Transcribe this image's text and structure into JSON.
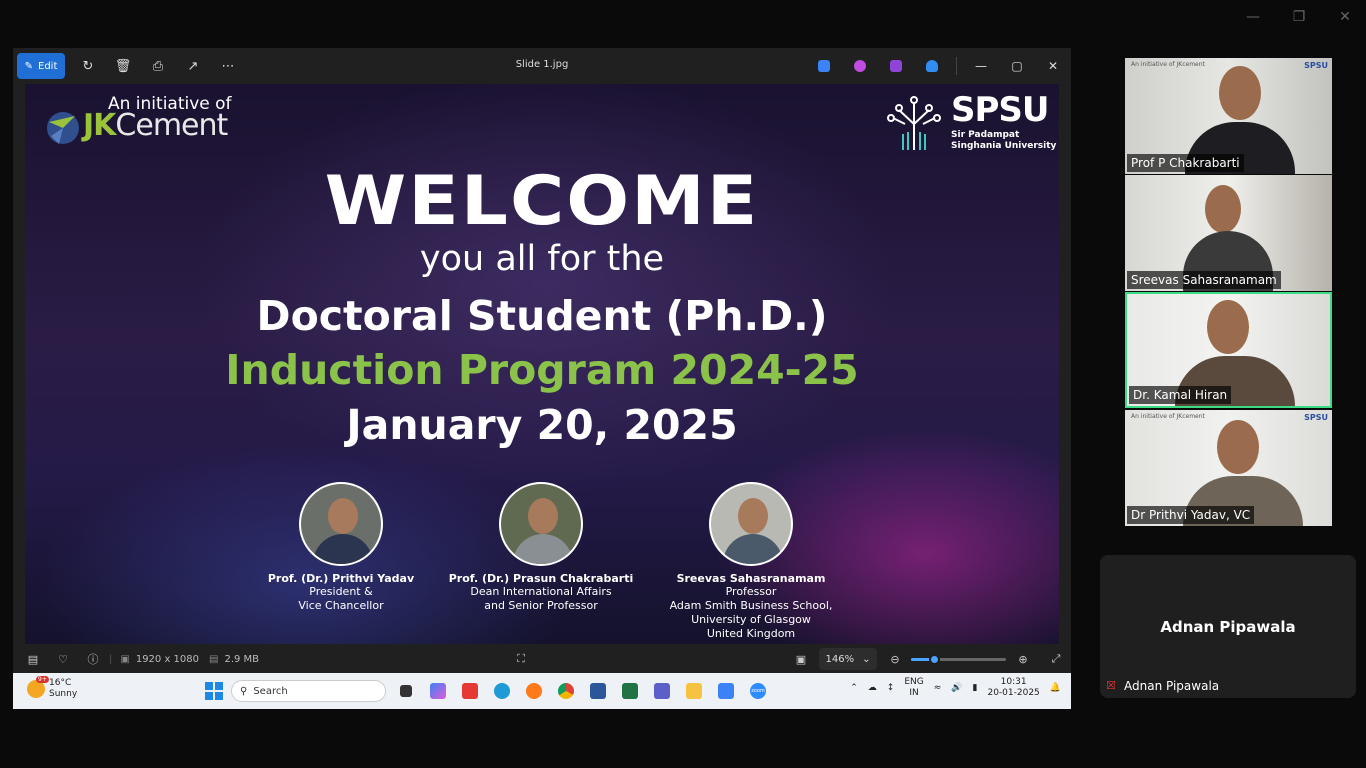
{
  "window": {
    "title": "Slide 1.jpg"
  },
  "toolbar": {
    "edit_label": "Edit"
  },
  "slide": {
    "initiative": "An initiative of",
    "jk_brand": {
      "jk": "JK",
      "cement": "Cement"
    },
    "spsu": {
      "name": "SPSU",
      "sub_line1": "Sir Padampat",
      "sub_line2": "Singhania University"
    },
    "welcome": "WELCOME",
    "line_you": "you all for the",
    "line_doc": "Doctoral Student (Ph.D.)",
    "line_ind": "Induction Program 2024-25",
    "line_date": "January 20, 2025",
    "speakers": [
      {
        "name": "Prof. (Dr.) Prithvi Yadav",
        "role1": "President &",
        "role2": "Vice Chancellor",
        "role3": "",
        "role4": ""
      },
      {
        "name": "Prof. (Dr.) Prasun Chakrabarti",
        "role1": "Dean International Affairs",
        "role2": "and Senior Professor",
        "role3": "",
        "role4": ""
      },
      {
        "name": "Sreevas Sahasranamam",
        "role1": "Professor",
        "role2": "Adam Smith Business School,",
        "role3": "University of Glasgow",
        "role4": "United Kingdom"
      }
    ]
  },
  "statusbar": {
    "resolution": "1920 x 1080",
    "size": "2.9 MB",
    "zoom": "146%",
    "zoom_level": 0.24
  },
  "taskbar": {
    "weather_temp": "16°C",
    "weather_desc": "Sunny",
    "weather_badge": "9+",
    "search_label": "Search",
    "lang": "ENG",
    "region": "IN",
    "time": "10:31",
    "date": "20-01-2025",
    "zoom_app_label": "zoom"
  },
  "participants": [
    {
      "name": "Prof P Chakrabarti"
    },
    {
      "name": "Sreevas Sahasranamam"
    },
    {
      "name": "Dr. Kamal Hiran"
    },
    {
      "name": "Dr Prithvi Yadav, VC"
    }
  ],
  "self_tile": {
    "name": "Adnan Pipawala",
    "label": "Adnan Pipawala"
  },
  "colors": {
    "accent_green": "#8bc34a",
    "active_border": "#3ddc84",
    "edit_blue": "#1f6fd6"
  }
}
